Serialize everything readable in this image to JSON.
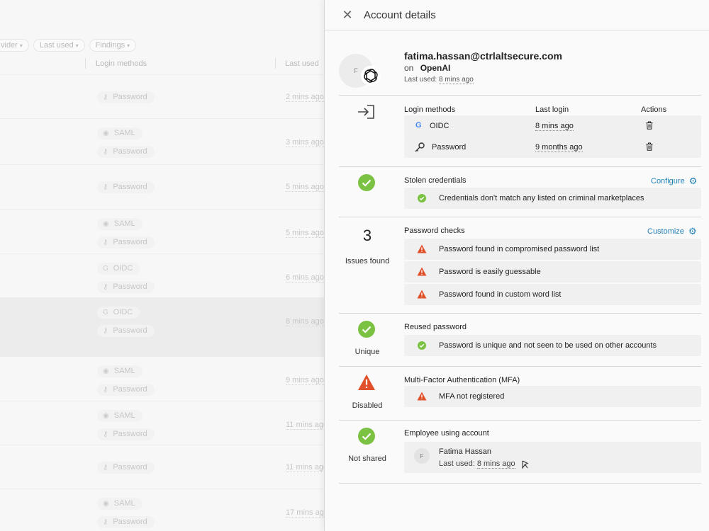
{
  "background": {
    "filters": [
      "vider",
      "Last used",
      "Findings"
    ],
    "columns": {
      "login_methods": "Login methods",
      "last_used": "Last used"
    },
    "rows": [
      {
        "methods": [
          "Password"
        ],
        "time": "2 mins ago"
      },
      {
        "methods": [
          "SAML",
          "Password"
        ],
        "time": "3 mins ago"
      },
      {
        "methods": [
          "Password"
        ],
        "time": "5 mins ago"
      },
      {
        "methods": [
          "SAML",
          "Password"
        ],
        "time": "5 mins ago"
      },
      {
        "methods": [
          "OIDC",
          "Password"
        ],
        "time": "6 mins ago"
      },
      {
        "methods": [
          "OIDC",
          "Password"
        ],
        "time": "8 mins ago"
      },
      {
        "methods": [
          "SAML",
          "Password"
        ],
        "time": "9 mins ago"
      },
      {
        "methods": [
          "SAML",
          "Password"
        ],
        "time": "11 mins ago"
      },
      {
        "methods": [
          "Password"
        ],
        "time": "11 mins ago"
      },
      {
        "methods": [
          "SAML",
          "Password"
        ],
        "time": "17 mins ago"
      }
    ]
  },
  "drawer": {
    "title": "Account details",
    "account": {
      "avatar_initial": "F",
      "email": "fatima.hassan@ctrlaltsecure.com",
      "on_label": "on",
      "app": "OpenAI",
      "last_used_label": "Last used:",
      "last_used": "8 mins ago"
    },
    "login": {
      "headers": {
        "methods": "Login methods",
        "last_login": "Last login",
        "actions": "Actions"
      },
      "rows": [
        {
          "method": "OIDC",
          "icon": "google-icon",
          "last": "8 mins ago"
        },
        {
          "method": "Password",
          "icon": "key-icon",
          "last": "9 months ago"
        }
      ]
    },
    "stolen": {
      "title": "Stolen credentials",
      "action": "Configure",
      "items": [
        "Credentials don't match any listed on criminal marketplaces"
      ]
    },
    "password_checks": {
      "count": "3",
      "caption": "Issues found",
      "title": "Password checks",
      "action": "Customize",
      "items": [
        "Password found in compromised password list",
        "Password is easily guessable",
        "Password found in custom word list"
      ]
    },
    "reused": {
      "caption": "Unique",
      "title": "Reused password",
      "items": [
        "Password is unique and not seen to be used on other accounts"
      ]
    },
    "mfa": {
      "caption": "Disabled",
      "title": "Multi-Factor Authentication (MFA)",
      "items": [
        "MFA not registered"
      ]
    },
    "employee": {
      "caption": "Not shared",
      "title": "Employee using account",
      "initial": "F",
      "name": "Fatima Hassan",
      "last_used_label": "Last used:",
      "last_used": "8 mins ago"
    },
    "colors": {
      "ok": "#7cc242",
      "warn": "#e0502a",
      "link": "#1f7fb6"
    }
  }
}
